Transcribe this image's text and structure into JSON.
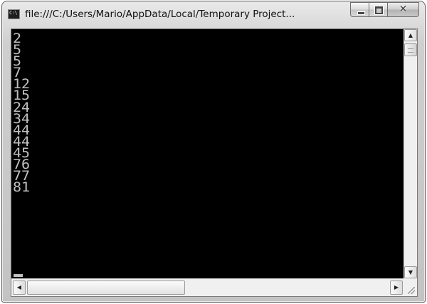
{
  "window": {
    "title": "file:///C:/Users/Mario/AppData/Local/Temporary Project...",
    "app_icon": "console-window-icon",
    "app_icon_text": "C:\\",
    "controls": {
      "minimize_icon": "minimize-icon",
      "maximize_icon": "maximize-icon",
      "close_icon": "close-icon",
      "close_glyph": "✕"
    }
  },
  "console": {
    "background": "#000000",
    "text_color": "#c0c0c0",
    "lines": [
      "2",
      "5",
      "5",
      "7",
      "12",
      "15",
      "24",
      "34",
      "44",
      "44",
      "45",
      "76",
      "77",
      "81"
    ]
  },
  "scrollbars": {
    "vertical": {
      "up_glyph": "▲",
      "down_glyph": "▼",
      "position": 0
    },
    "horizontal": {
      "left_glyph": "◀",
      "right_glyph": "▶",
      "position": 0
    }
  }
}
